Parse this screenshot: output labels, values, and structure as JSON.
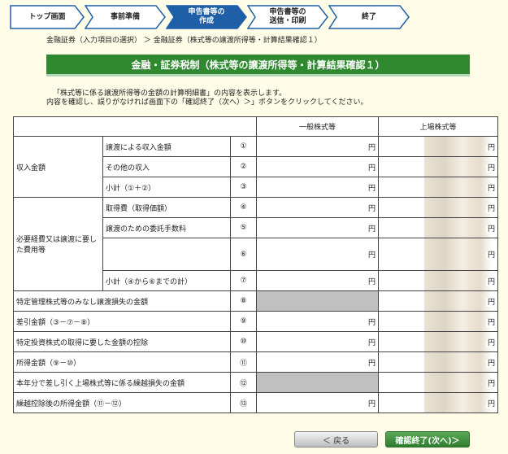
{
  "steps": [
    {
      "label": "トップ画面",
      "active": false
    },
    {
      "label": "事前準備",
      "active": false
    },
    {
      "label": "申告書等の\n作成",
      "active": true
    },
    {
      "label": "申告書等の\n送信・印刷",
      "active": false
    },
    {
      "label": "終了",
      "active": false
    }
  ],
  "breadcrumb": "金融証券（入力項目の選択） ＞ 金融証券（株式等の譲渡所得等・計算結果確認１）",
  "title": "金融・証券税制（株式等の譲渡所得等・計算結果確認１）",
  "description": [
    "「株式等に係る譲渡所得等の金額の計算明細書」の内容を表示します。",
    "内容を確認し、誤りがなければ画面下の「確認終了（次へ）＞」ボタンをクリックしてください。"
  ],
  "table": {
    "col_general": "一般株式等",
    "col_listed": "上場株式等",
    "yen": "円",
    "group_income": "収入金額",
    "group_expense": "必要経費又は譲渡に要した費用等",
    "rows": [
      {
        "label": "譲渡による収入金額",
        "num": "①"
      },
      {
        "label": "その他の収入",
        "num": "②"
      },
      {
        "label": "小計（①＋②）",
        "num": "③"
      },
      {
        "label": "取得費（取得価額）",
        "num": "④"
      },
      {
        "label": "譲渡のための委託手数料",
        "num": "⑤"
      },
      {
        "label": "",
        "num": "⑥"
      },
      {
        "label": "小計（④から⑥までの計）",
        "num": "⑦"
      },
      {
        "label": "特定管理株式等のみなし譲渡損失の金額",
        "num": "⑧"
      },
      {
        "label": "差引金額（③－⑦－⑧）",
        "num": "⑨"
      },
      {
        "label": "特定投資株式の取得に要した金額の控除",
        "num": "⑩"
      },
      {
        "label": "所得金額（⑨－⑩）",
        "num": "⑪"
      },
      {
        "label": "本年分で差し引く上場株式等に係る繰越損失の金額",
        "num": "⑫"
      },
      {
        "label": "繰越控除後の所得金額（⑪－⑫）",
        "num": "⑬"
      }
    ]
  },
  "buttons": {
    "back": "＜ 戻る",
    "next": "確認終了(次へ)＞"
  },
  "colors": {
    "title_bg": "#2f8a2f",
    "active_step": "#1f5fa8",
    "page_bg": "#fffde7"
  }
}
